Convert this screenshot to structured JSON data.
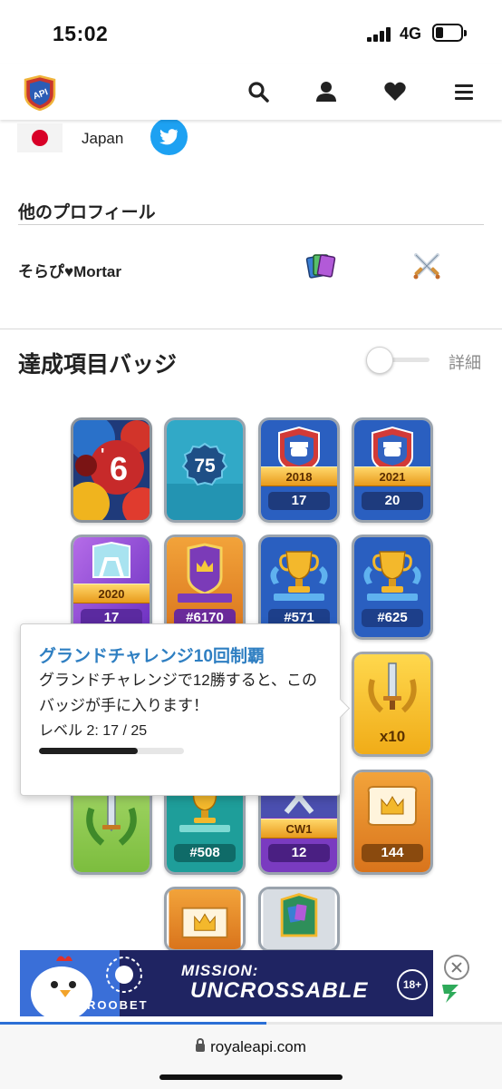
{
  "status_bar": {
    "time": "15:02",
    "network": "4G",
    "battery_percent": 30
  },
  "nav": {
    "logo_text": "API",
    "icons": [
      "search-icon",
      "user-icon",
      "heart-icon",
      "menu-icon"
    ]
  },
  "profile": {
    "country": "Japan",
    "other_profiles_heading": "他のプロフィール",
    "other_profile_name": "そらぴ♥Mortar"
  },
  "badges": {
    "title": "達成項目バッジ",
    "toggle_label": "詳細",
    "toggle_on": false,
    "items": [
      {
        "icon": "6-years-badge-icon"
      },
      {
        "icon": "level-75-badge-icon",
        "text": "75"
      },
      {
        "icon": "crl-2018-badge-icon",
        "ribbon": "2018",
        "count": "17"
      },
      {
        "icon": "crl-2021-badge-icon",
        "ribbon": "2021",
        "count": "20"
      },
      {
        "icon": "crl-2020-badge-icon",
        "ribbon": "2020",
        "count": "17"
      },
      {
        "icon": "crown-shield-badge-icon",
        "count": "#6170"
      },
      {
        "icon": "trophy-badge-icon",
        "count": "#571"
      },
      {
        "icon": "trophy-badge-icon",
        "count": "#625"
      },
      {
        "icon": "grand-challenge-badge-icon",
        "count": "x10"
      },
      {
        "icon": "laurel-sword-badge-icon"
      },
      {
        "icon": "trophy-teal-badge-icon",
        "count": "#508"
      },
      {
        "icon": "cw1-badge-icon",
        "ribbon": "CW1",
        "count": "12"
      },
      {
        "icon": "crown-card-badge-icon",
        "count": "144"
      },
      {
        "icon": "crown-flag-badge-icon"
      },
      {
        "icon": "deck-badge-icon"
      }
    ]
  },
  "tooltip": {
    "title": "グランドチャレンジ10回制覇",
    "body": "グランドチャレンジで12勝すると、このバッジが手に入ります！",
    "level": "レベル 2: 17 / 25",
    "progress": 0.68
  },
  "ad": {
    "brand": "ROOBET",
    "headline_1": "MISSION:",
    "headline_2": "UNCROSSABLE",
    "age": "18+"
  },
  "browser": {
    "url": "royaleapi.com",
    "load_progress": 0.53
  }
}
